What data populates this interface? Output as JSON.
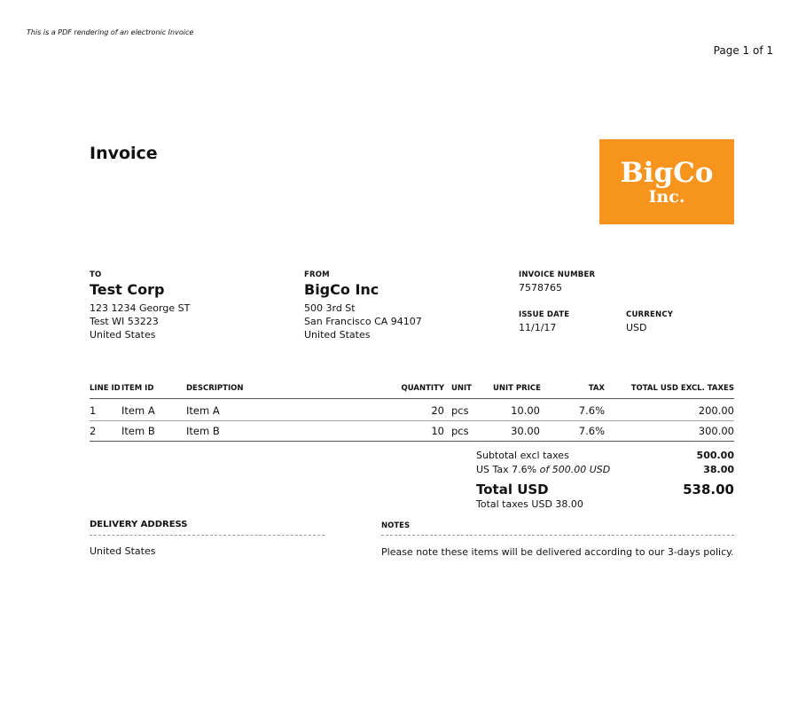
{
  "header": {
    "pdf_note": "This is a PDF rendering of an electronic Invoice",
    "page": "Page 1 of 1",
    "title": "Invoice"
  },
  "logo": {
    "line1": "BigCo",
    "line2": "Inc.",
    "color": "#f7941d"
  },
  "to": {
    "label": "TO",
    "name": "Test Corp",
    "address": [
      "123 1234 George ST",
      "Test WI 53223",
      "United States"
    ]
  },
  "from": {
    "label": "FROM",
    "name": "BigCo Inc",
    "address": [
      "500 3rd St",
      "San Francisco CA 94107",
      "United States"
    ]
  },
  "meta": {
    "invoice_number_label": "INVOICE NUMBER",
    "invoice_number": "7578765",
    "issue_date_label": "ISSUE DATE",
    "issue_date": "11/1/17",
    "currency_label": "CURRENCY",
    "currency": "USD"
  },
  "table": {
    "headers": {
      "line_id": "LINE ID",
      "item_id": "ITEM ID",
      "description": "DESCRIPTION",
      "quantity": "QUANTITY",
      "unit": "UNIT",
      "unit_price": "UNIT PRICE",
      "tax": "TAX",
      "total": "TOTAL USD EXCL. TAXES"
    },
    "rows": [
      {
        "line_id": "1",
        "item_id": "Item A",
        "description": "Item A",
        "quantity": "20",
        "unit": "pcs",
        "unit_price": "10.00",
        "tax": "7.6%",
        "total": "200.00"
      },
      {
        "line_id": "2",
        "item_id": "Item B",
        "description": "Item B",
        "quantity": "10",
        "unit": "pcs",
        "unit_price": "30.00",
        "tax": "7.6%",
        "total": "300.00"
      }
    ]
  },
  "totals": {
    "subtotal_label": "Subtotal excl taxes",
    "subtotal": "500.00",
    "tax_label": "US Tax 7.6%",
    "tax_of": "of 500.00 USD",
    "tax": "38.00",
    "total_label": "Total USD",
    "total": "538.00",
    "total_taxes": "Total taxes USD 38.00"
  },
  "delivery": {
    "label": "DELIVERY ADDRESS",
    "value": "United States"
  },
  "notes": {
    "label": "NOTES",
    "value": "Please note these items will be delivered according to our 3-days policy."
  }
}
